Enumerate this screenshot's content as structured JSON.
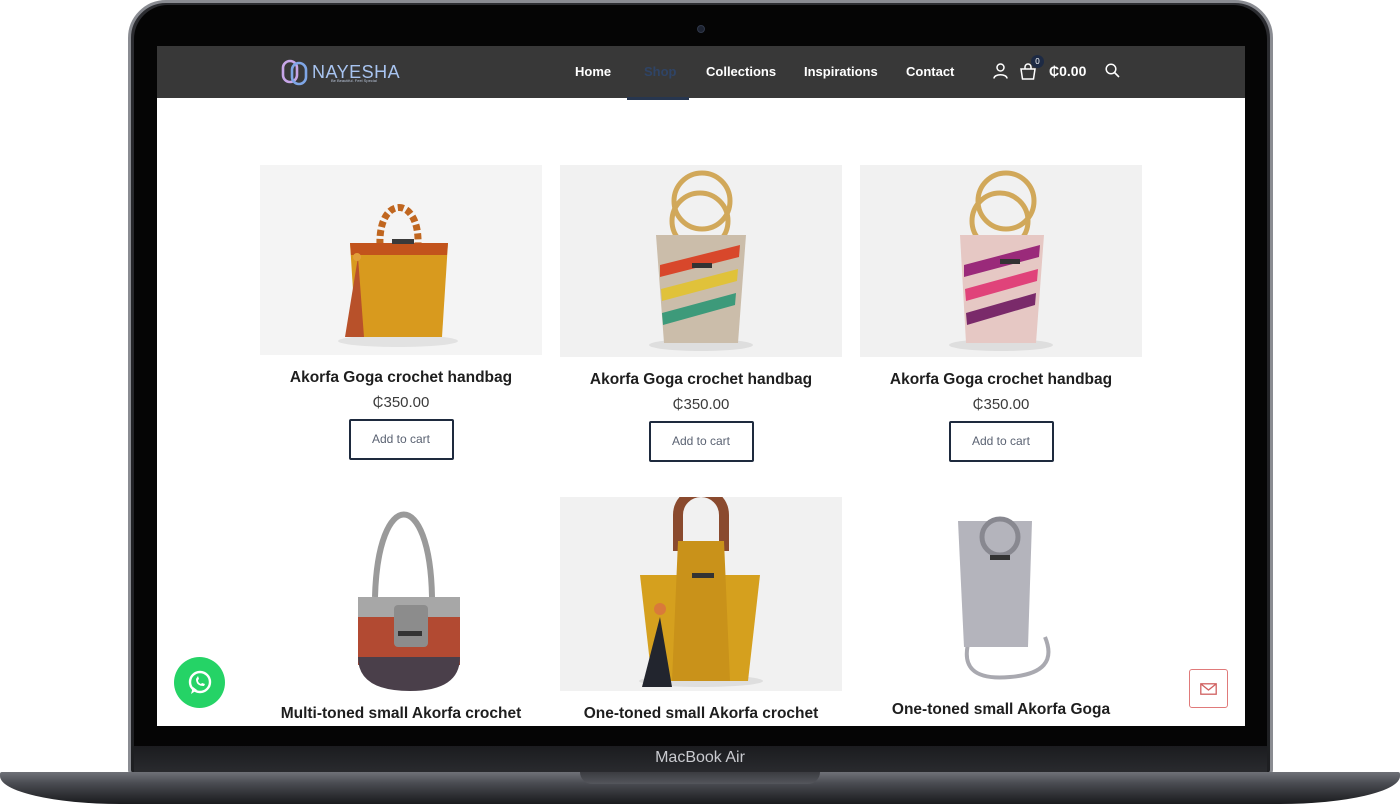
{
  "device": {
    "label": "MacBook Air"
  },
  "header": {
    "brand": "NAYESHA",
    "tagline": "Be Beautiful. Feel Special",
    "nav": [
      {
        "label": "Home",
        "active": false
      },
      {
        "label": "Shop",
        "active": true
      },
      {
        "label": "Collections",
        "active": false
      },
      {
        "label": "Inspirations",
        "active": false
      },
      {
        "label": "Contact",
        "active": false
      }
    ],
    "cart_count": "0",
    "cart_total": "₵0.00",
    "icons": [
      "user-icon",
      "cart-icon",
      "search-icon"
    ]
  },
  "products": [
    {
      "name": "Akorfa Goga crochet handbag",
      "price": "₵350.00",
      "button": "Add to cart",
      "image": "mustard-bag-bead-handle"
    },
    {
      "name": "Akorfa Goga crochet handbag",
      "price": "₵350.00",
      "button": "Add to cart",
      "image": "striped-bag-bamboo-handles"
    },
    {
      "name": "Akorfa Goga crochet handbag",
      "price": "₵350.00",
      "button": "Add to cart",
      "image": "pink-purple-bag-bamboo-handles"
    },
    {
      "name": "Multi-toned small Akorfa crochet",
      "image": "grey-red-brown-shoulder-bag"
    },
    {
      "name": "One-toned small Akorfa crochet",
      "image": "mustard-bag-wooden-handle"
    },
    {
      "name": "One-toned small Akorfa Goga",
      "image": "silver-crossbody-bag"
    }
  ],
  "floating": {
    "whatsapp": "whatsapp-icon",
    "mail": "mail-icon"
  },
  "colors": {
    "header_bg": "#383838",
    "accent": "#25d366",
    "button_border": "#1e2a3e"
  }
}
